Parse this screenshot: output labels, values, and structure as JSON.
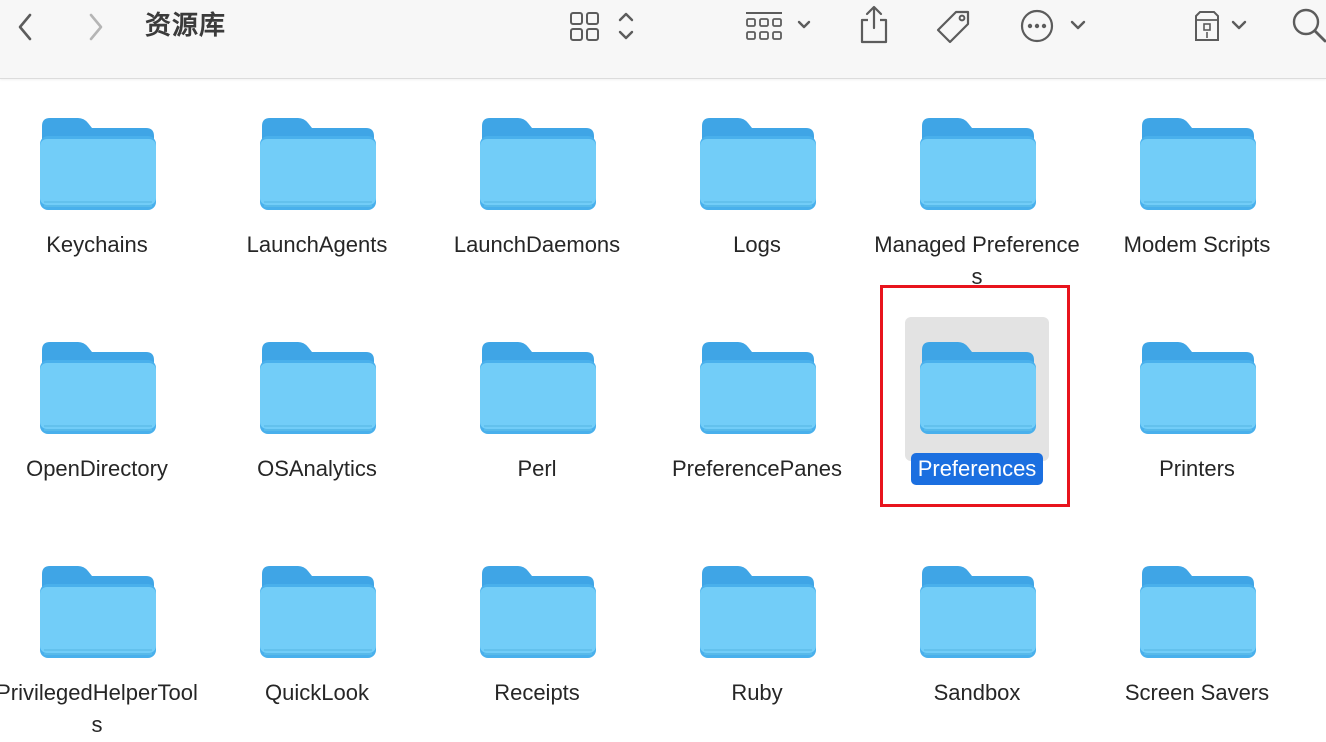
{
  "toolbar": {
    "title": "资源库"
  },
  "icons": {
    "back": "chevron-left-icon",
    "forward": "chevron-right-icon",
    "view": "icon-grid-view-icon",
    "group": "group-by-icon",
    "share": "share-icon",
    "tag": "tag-icon",
    "more": "ellipsis-circle-icon",
    "quicklook": "preview-pane-icon",
    "search": "search-icon"
  },
  "colors": {
    "selection": "#1b6fe0",
    "folder_body": "#6fcbf6",
    "folder_tab": "#3fa5e6",
    "annotation": "#e8141d"
  },
  "folders": [
    {
      "name": "Keychains"
    },
    {
      "name": "LaunchAgents"
    },
    {
      "name": "LaunchDaemons"
    },
    {
      "name": "Logs"
    },
    {
      "name": "Managed Preferences"
    },
    {
      "name": "Modem Scripts"
    },
    {
      "name": "OpenDirectory"
    },
    {
      "name": "OSAnalytics"
    },
    {
      "name": "Perl"
    },
    {
      "name": "PreferencePanes"
    },
    {
      "name": "Preferences",
      "selected": true
    },
    {
      "name": "Printers"
    },
    {
      "name": "PrivilegedHelperTools"
    },
    {
      "name": "QuickLook"
    },
    {
      "name": "Receipts"
    },
    {
      "name": "Ruby"
    },
    {
      "name": "Sandbox"
    },
    {
      "name": "Screen Savers"
    }
  ]
}
